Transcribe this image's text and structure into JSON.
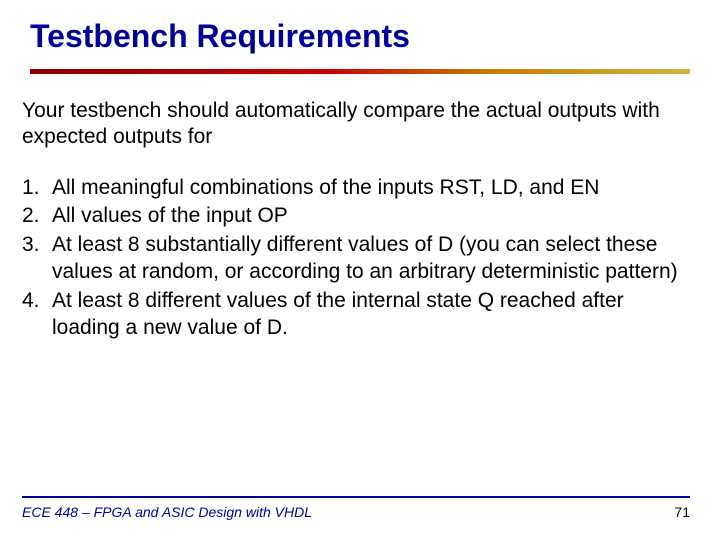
{
  "title": "Testbench Requirements",
  "intro": "Your testbench should automatically compare the actual outputs with expected outputs for",
  "items": {
    "n1": "1.",
    "t1": "All meaningful combinations of the inputs RST, LD, and EN",
    "n2": "2.",
    "t2": "All values of the input OP",
    "n3": "3.",
    "t3": "At least 8 substantially different values of D (you can select these values at random, or according to an arbitrary deterministic pattern)",
    "n4": "4.",
    "t4": "At least 8 different values of the internal state Q reached after loading a new value of D."
  },
  "footer": {
    "course": "ECE 448 – FPGA and ASIC Design with VHDL",
    "page": "71"
  }
}
